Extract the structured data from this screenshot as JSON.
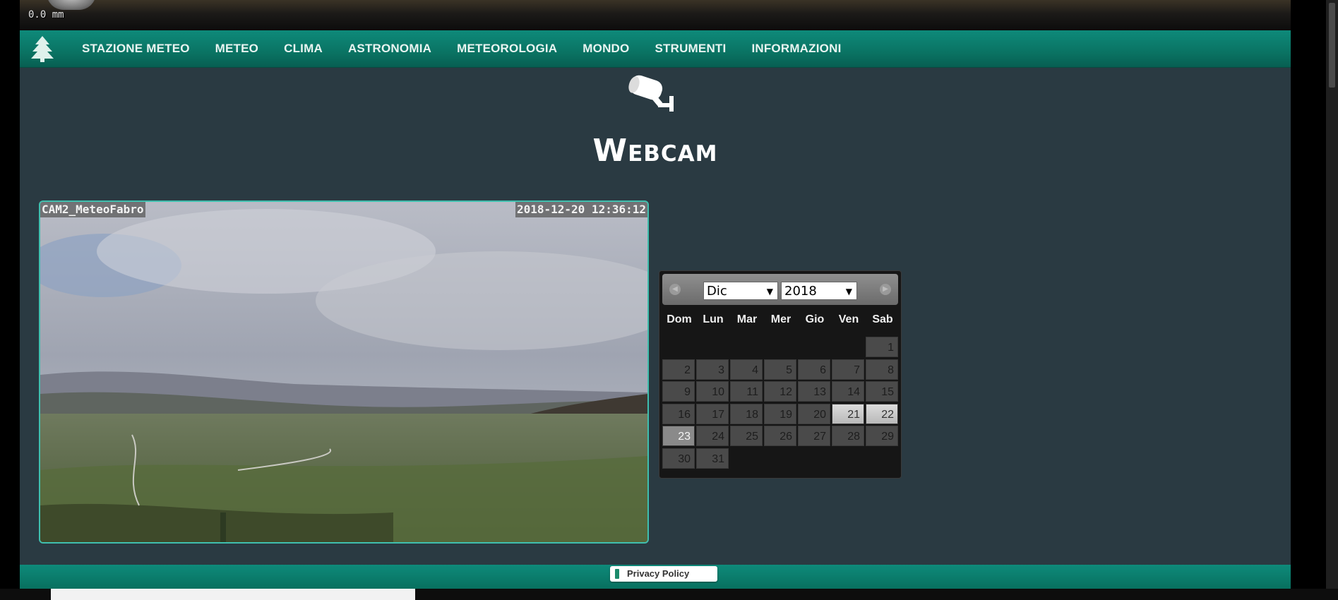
{
  "banner": {
    "rain_readout": "0.0 mm"
  },
  "nav": {
    "items": [
      {
        "label": "STAZIONE METEO"
      },
      {
        "label": "METEO"
      },
      {
        "label": "CLIMA"
      },
      {
        "label": "ASTRONOMIA"
      },
      {
        "label": "METEOROLOGIA"
      },
      {
        "label": "MONDO"
      },
      {
        "label": "STRUMENTI"
      },
      {
        "label": "INFORMAZIONI"
      }
    ]
  },
  "main": {
    "title": "Webcam"
  },
  "webcam": {
    "camera_name": "CAM2_MeteoFabro",
    "timestamp": "2018-12-20 12:36:12"
  },
  "calendar": {
    "month": "Dic",
    "year": "2018",
    "weekdays": [
      "Dom",
      "Lun",
      "Mar",
      "Mer",
      "Gio",
      "Ven",
      "Sab"
    ],
    "first_weekday_index": 6,
    "days_in_month": 31,
    "highlighted_days": [
      21,
      22
    ],
    "today": 23
  },
  "footer": {
    "privacy_label": "Privacy Policy"
  },
  "colors": {
    "nav_bg": "#0a7363",
    "page_bg": "#2a3a42",
    "frame_border": "#3fbfae",
    "calendar_bg": "#161616"
  },
  "icons": {
    "logo": "pine-tree-icon",
    "section": "security-camera-icon",
    "privacy": "iubenda-icon"
  }
}
